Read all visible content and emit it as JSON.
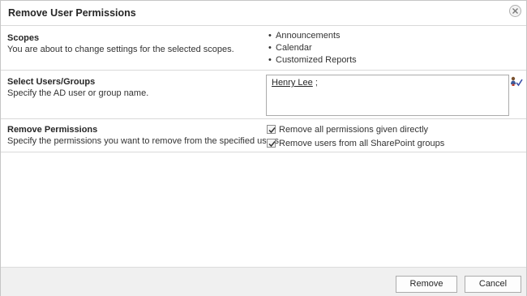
{
  "dialog": {
    "title": "Remove User Permissions",
    "close_icon": "close-icon"
  },
  "scopes": {
    "title": "Scopes",
    "description": "You are about to change settings for the selected scopes.",
    "items": [
      "Announcements",
      "Calendar",
      "Customized Reports"
    ]
  },
  "users": {
    "title": "Select Users/Groups",
    "description": "Specify the AD user or group name.",
    "resolved_name": "Henry Lee",
    "separator": ";",
    "picker_icon": "check-names-icon"
  },
  "permissions": {
    "title": "Remove Permissions",
    "description": "Specify the permissions you want to remove from the specified users.",
    "options": [
      {
        "label": "Remove all permissions given directly",
        "checked": true
      },
      {
        "label": "Remove users from all SharePoint groups",
        "checked": true
      }
    ]
  },
  "footer": {
    "remove_label": "Remove",
    "cancel_label": "Cancel"
  }
}
